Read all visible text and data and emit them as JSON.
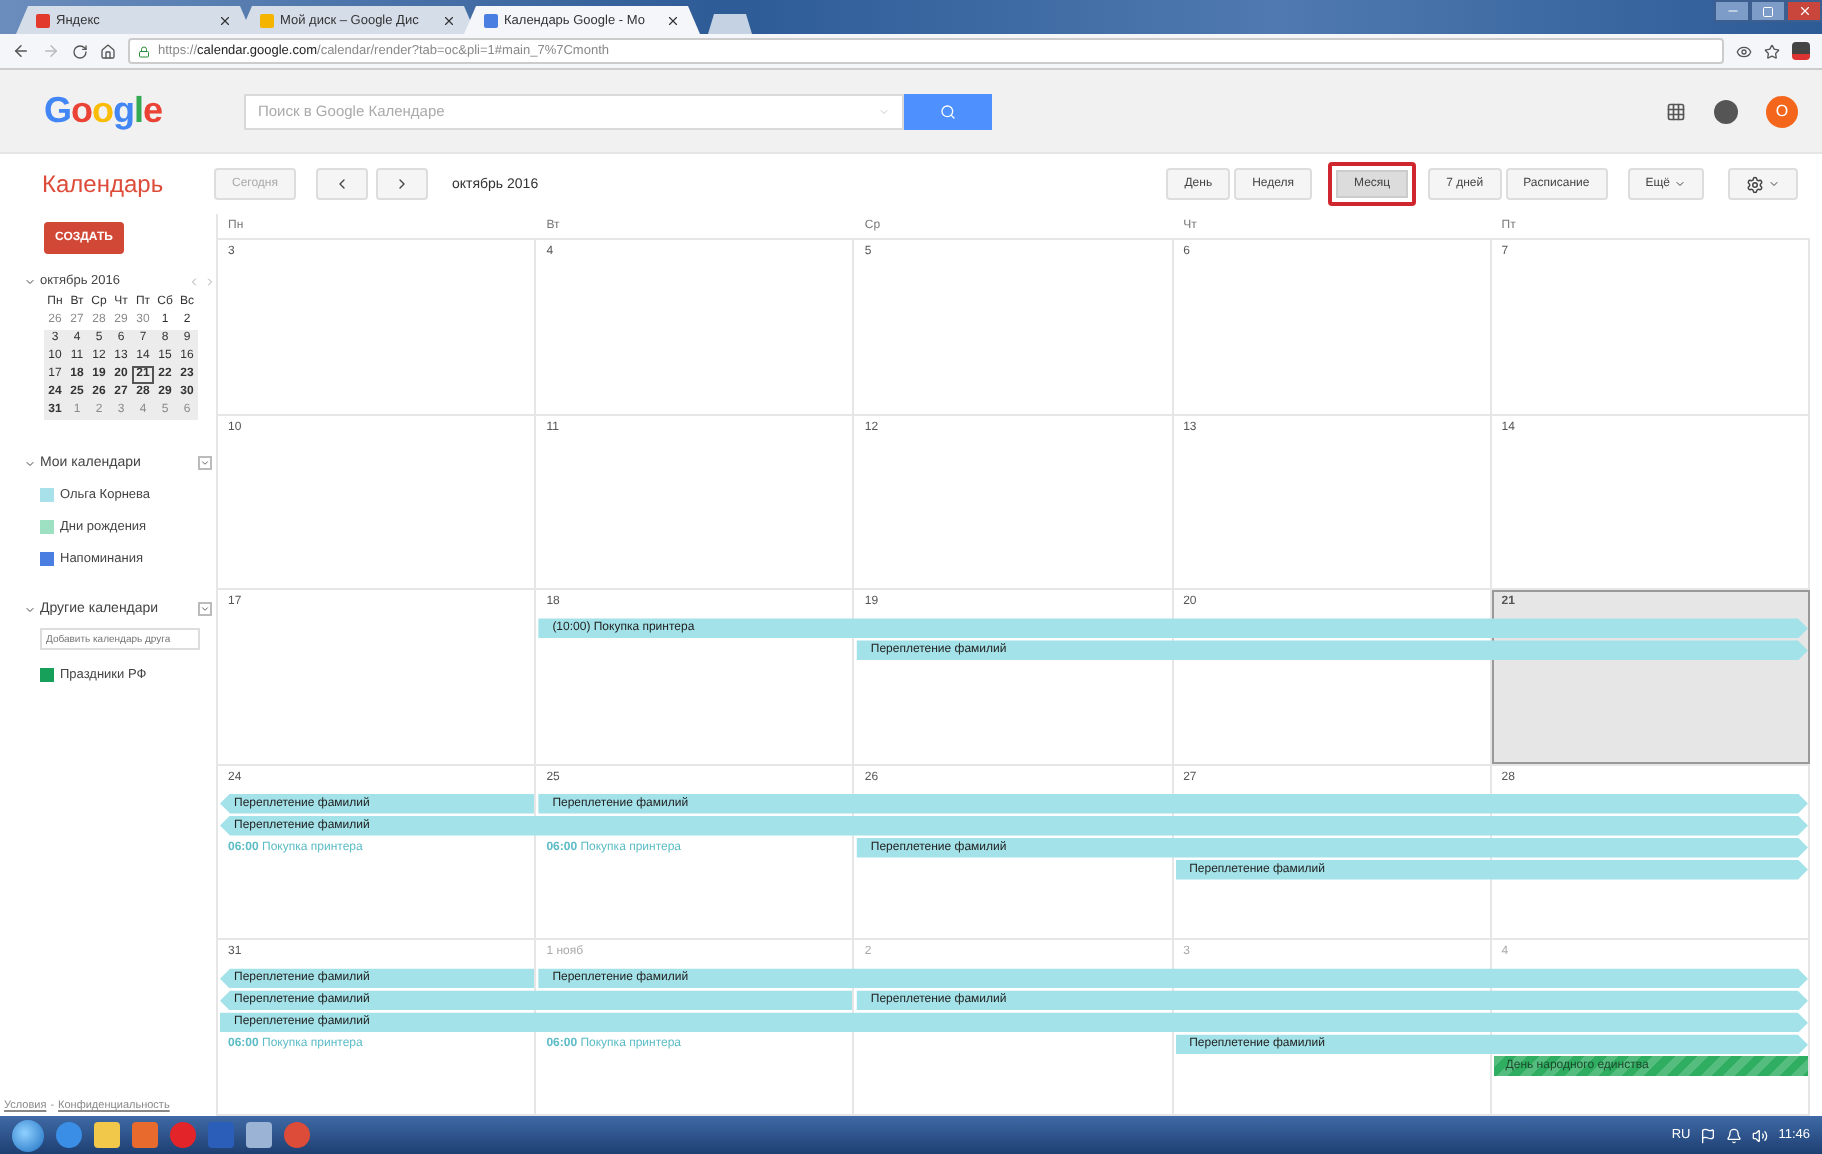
{
  "browser": {
    "tabs": [
      {
        "title": "Яндекс",
        "selected": false
      },
      {
        "title": "Мой диск – Google Дис",
        "selected": false
      },
      {
        "title": "Календарь Google - Мо",
        "selected": true
      }
    ],
    "url": "https://**calendar.google.com**/calendar/render?tab=oc&pli=1#main_7%7Cmonth"
  },
  "header": {
    "logo": "Google",
    "search": {
      "placeholder": "Поиск в Google Календаре"
    },
    "avatar": "О"
  },
  "toolbar": {
    "app_title": "Календарь",
    "today": "Сегодня",
    "period": "октябрь 2016",
    "views": [
      {
        "label": "День",
        "selected": false,
        "outlined": false
      },
      {
        "label": "Неделя",
        "selected": false,
        "outlined": false
      },
      {
        "label": "Месяц",
        "selected": true,
        "outlined": true
      },
      {
        "label": "7 дней",
        "selected": false,
        "outlined": false
      },
      {
        "label": "Расписание",
        "selected": false,
        "outlined": false
      }
    ],
    "more": "Ещё"
  },
  "sidebar": {
    "create": "СОЗДАТЬ",
    "mini_calendar": {
      "title": "октябрь 2016",
      "weekdays": [
        "Пн",
        "Вт",
        "Ср",
        "Чт",
        "Пт",
        "Сб",
        "Вс"
      ],
      "weeks": [
        {
          "in_view": false,
          "days": [
            {
              "d": "26",
              "muted": true,
              "bold": false,
              "today": false
            },
            {
              "d": "27",
              "muted": true,
              "bold": false,
              "today": false
            },
            {
              "d": "28",
              "muted": true,
              "bold": false,
              "today": false
            },
            {
              "d": "29",
              "muted": true,
              "bold": false,
              "today": false
            },
            {
              "d": "30",
              "muted": true,
              "bold": false,
              "today": false
            },
            {
              "d": "1",
              "muted": false,
              "bold": false,
              "today": false
            },
            {
              "d": "2",
              "muted": false,
              "bold": false,
              "today": false
            }
          ]
        },
        {
          "in_view": true,
          "days": [
            {
              "d": "3",
              "muted": false,
              "bold": false,
              "today": false
            },
            {
              "d": "4",
              "muted": false,
              "bold": false,
              "today": false
            },
            {
              "d": "5",
              "muted": false,
              "bold": false,
              "today": false
            },
            {
              "d": "6",
              "muted": false,
              "bold": false,
              "today": false
            },
            {
              "d": "7",
              "muted": false,
              "bold": false,
              "today": false
            },
            {
              "d": "8",
              "muted": false,
              "bold": false,
              "today": false
            },
            {
              "d": "9",
              "muted": false,
              "bold": false,
              "today": false
            }
          ]
        },
        {
          "in_view": true,
          "days": [
            {
              "d": "10",
              "muted": false,
              "bold": false,
              "today": false
            },
            {
              "d": "11",
              "muted": false,
              "bold": false,
              "today": false
            },
            {
              "d": "12",
              "muted": false,
              "bold": false,
              "today": false
            },
            {
              "d": "13",
              "muted": false,
              "bold": false,
              "today": false
            },
            {
              "d": "14",
              "muted": false,
              "bold": false,
              "today": false
            },
            {
              "d": "15",
              "muted": false,
              "bold": false,
              "today": false
            },
            {
              "d": "16",
              "muted": false,
              "bold": false,
              "today": false
            }
          ]
        },
        {
          "in_view": true,
          "days": [
            {
              "d": "17",
              "muted": false,
              "bold": false,
              "today": false
            },
            {
              "d": "18",
              "muted": false,
              "bold": true,
              "today": false
            },
            {
              "d": "19",
              "muted": false,
              "bold": true,
              "today": false
            },
            {
              "d": "20",
              "muted": false,
              "bold": true,
              "today": false
            },
            {
              "d": "21",
              "muted": false,
              "bold": true,
              "today": true
            },
            {
              "d": "22",
              "muted": false,
              "bold": true,
              "today": false
            },
            {
              "d": "23",
              "muted": false,
              "bold": true,
              "today": false
            }
          ]
        },
        {
          "in_view": true,
          "days": [
            {
              "d": "24",
              "muted": false,
              "bold": true,
              "today": false
            },
            {
              "d": "25",
              "muted": false,
              "bold": true,
              "today": false
            },
            {
              "d": "26",
              "muted": false,
              "bold": true,
              "today": false
            },
            {
              "d": "27",
              "muted": false,
              "bold": true,
              "today": false
            },
            {
              "d": "28",
              "muted": false,
              "bold": true,
              "today": false
            },
            {
              "d": "29",
              "muted": false,
              "bold": true,
              "today": false
            },
            {
              "d": "30",
              "muted": false,
              "bold": true,
              "today": false
            }
          ]
        },
        {
          "in_view": true,
          "days": [
            {
              "d": "31",
              "muted": false,
              "bold": true,
              "today": false
            },
            {
              "d": "1",
              "muted": true,
              "bold": false,
              "today": false
            },
            {
              "d": "2",
              "muted": true,
              "bold": false,
              "today": false
            },
            {
              "d": "3",
              "muted": true,
              "bold": false,
              "today": false
            },
            {
              "d": "4",
              "muted": true,
              "bold": false,
              "today": false
            },
            {
              "d": "5",
              "muted": true,
              "bold": false,
              "today": false
            },
            {
              "d": "6",
              "muted": true,
              "bold": false,
              "today": false
            }
          ]
        }
      ]
    },
    "groups": [
      {
        "title": "Мои календари",
        "expanded": true,
        "items": [
          {
            "name": "Ольга Корнева",
            "color": "#a8e1ea"
          },
          {
            "name": "Дни рождения",
            "color": "#9ee0c2"
          },
          {
            "name": "Напоминания",
            "color": "#4a7ee0"
          }
        ]
      },
      {
        "title": "Другие календари",
        "expanded": true,
        "add_field": {
          "placeholder": "Добавить календарь друга"
        },
        "items": [
          {
            "name": "Праздники РФ",
            "color": "#16a05a"
          }
        ]
      }
    ],
    "footer": {
      "links": [
        "Условия",
        "Конфиденциальность"
      ],
      "separator": "-"
    }
  },
  "month": {
    "weekdays": [
      "Пн",
      "Вт",
      "Ср",
      "Чт",
      "Пт"
    ],
    "weeks": [
      {
        "days": [
          {
            "date": "3",
            "today": false,
            "muted": false
          },
          {
            "date": "4",
            "today": false,
            "muted": false
          },
          {
            "date": "5",
            "today": false,
            "muted": false
          },
          {
            "date": "6",
            "today": false,
            "muted": false
          },
          {
            "date": "7",
            "today": false,
            "muted": false
          }
        ]
      },
      {
        "days": [
          {
            "date": "10",
            "today": false,
            "muted": false
          },
          {
            "date": "11",
            "today": false,
            "muted": false
          },
          {
            "date": "12",
            "today": false,
            "muted": false
          },
          {
            "date": "13",
            "today": false,
            "muted": false
          },
          {
            "date": "14",
            "today": false,
            "muted": false
          }
        ]
      },
      {
        "days": [
          {
            "date": "17",
            "today": false,
            "muted": false
          },
          {
            "date": "18",
            "today": false,
            "muted": false
          },
          {
            "date": "19",
            "today": false,
            "muted": false
          },
          {
            "date": "20",
            "today": false,
            "muted": false
          },
          {
            "date": "21",
            "today": true,
            "muted": false
          }
        ],
        "lanes": [
          [
            {
              "kind": "empty"
            },
            {
              "kind": "bar",
              "title": "(10:00) Покупка принтера",
              "from_before": false,
              "to_after": true,
              "color": "#a3e2e8"
            },
            {
              "kind": "cont"
            },
            {
              "kind": "cont"
            },
            {
              "kind": "cont"
            }
          ],
          [
            {
              "kind": "empty"
            },
            {
              "kind": "empty"
            },
            {
              "kind": "bar",
              "title": "Переплетение фамилий",
              "from_before": false,
              "to_after": true,
              "color": "#a3e2e8"
            },
            {
              "kind": "cont"
            },
            {
              "kind": "cont"
            }
          ]
        ]
      },
      {
        "days": [
          {
            "date": "24",
            "today": false,
            "muted": false
          },
          {
            "date": "25",
            "today": false,
            "muted": false
          },
          {
            "date": "26",
            "today": false,
            "muted": false
          },
          {
            "date": "27",
            "today": false,
            "muted": false
          },
          {
            "date": "28",
            "today": false,
            "muted": false
          }
        ],
        "lanes": [
          [
            {
              "kind": "bar",
              "title": "Переплетение фамилий",
              "from_before": true,
              "to_after": false,
              "color": "#a3e2e8"
            },
            {
              "kind": "bar",
              "title": "Переплетение фамилий",
              "from_before": false,
              "to_after": true,
              "color": "#a3e2e8"
            },
            {
              "kind": "cont"
            },
            {
              "kind": "cont"
            },
            {
              "kind": "cont"
            }
          ],
          [
            {
              "kind": "bar",
              "title": "Переплетение фамилий",
              "from_before": true,
              "to_after": true,
              "color": "#a3e2e8"
            },
            {
              "kind": "cont"
            },
            {
              "kind": "cont"
            },
            {
              "kind": "cont"
            },
            {
              "kind": "cont"
            }
          ],
          [
            {
              "kind": "timed",
              "time": "06:00",
              "title": "Покупка принтера",
              "color": "#5bbcc6"
            },
            {
              "kind": "timed",
              "time": "06:00",
              "title": "Покупка принтера",
              "color": "#5bbcc6"
            },
            {
              "kind": "bar",
              "title": "Переплетение фамилий",
              "from_before": false,
              "to_after": true,
              "color": "#a3e2e8"
            },
            {
              "kind": "cont"
            },
            {
              "kind": "cont"
            }
          ],
          [
            {
              "kind": "empty"
            },
            {
              "kind": "empty"
            },
            {
              "kind": "empty"
            },
            {
              "kind": "bar",
              "title": "Переплетение фамилий",
              "from_before": false,
              "to_after": true,
              "color": "#a3e2e8"
            },
            {
              "kind": "cont"
            }
          ]
        ]
      },
      {
        "days": [
          {
            "date": "31",
            "today": false,
            "muted": false
          },
          {
            "date": "1 нояб",
            "today": false,
            "muted": true
          },
          {
            "date": "2",
            "today": false,
            "muted": true
          },
          {
            "date": "3",
            "today": false,
            "muted": true
          },
          {
            "date": "4",
            "today": false,
            "muted": true
          }
        ],
        "lanes": [
          [
            {
              "kind": "bar",
              "title": "Переплетение фамилий",
              "from_before": true,
              "to_after": false,
              "color": "#a3e2e8"
            },
            {
              "kind": "bar",
              "title": "Переплетение фамилий",
              "from_before": false,
              "to_after": true,
              "color": "#a3e2e8"
            },
            {
              "kind": "cont"
            },
            {
              "kind": "cont"
            },
            {
              "kind": "cont"
            }
          ],
          [
            {
              "kind": "bar",
              "title": "Переплетение фамилий",
              "from_before": true,
              "to_after": false,
              "color": "#a3e2e8"
            },
            {
              "kind": "cont"
            },
            {
              "kind": "bar",
              "title": "Переплетение фамилий",
              "from_before": false,
              "to_after": true,
              "color": "#a3e2e8"
            },
            {
              "kind": "cont"
            },
            {
              "kind": "cont"
            }
          ],
          [
            {
              "kind": "bar",
              "title": "Переплетение фамилий",
              "from_before": false,
              "to_after": true,
              "color": "#a3e2e8"
            },
            {
              "kind": "cont"
            },
            {
              "kind": "cont"
            },
            {
              "kind": "cont"
            },
            {
              "kind": "cont"
            }
          ],
          [
            {
              "kind": "timed",
              "time": "06:00",
              "title": "Покупка принтера",
              "color": "#5bbcc6"
            },
            {
              "kind": "timed",
              "time": "06:00",
              "title": "Покупка принтера",
              "color": "#5bbcc6"
            },
            {
              "kind": "empty"
            },
            {
              "kind": "bar",
              "title": "Переплетение фамилий",
              "from_before": false,
              "to_after": true,
              "color": "#a3e2e8"
            },
            {
              "kind": "cont"
            }
          ],
          [
            {
              "kind": "empty"
            },
            {
              "kind": "empty"
            },
            {
              "kind": "empty"
            },
            {
              "kind": "empty"
            },
            {
              "kind": "holiday",
              "title": "День народного единства",
              "color": "#2fae62"
            }
          ]
        ]
      }
    ]
  },
  "taskbar": {
    "language": "RU",
    "time": "11:46"
  }
}
